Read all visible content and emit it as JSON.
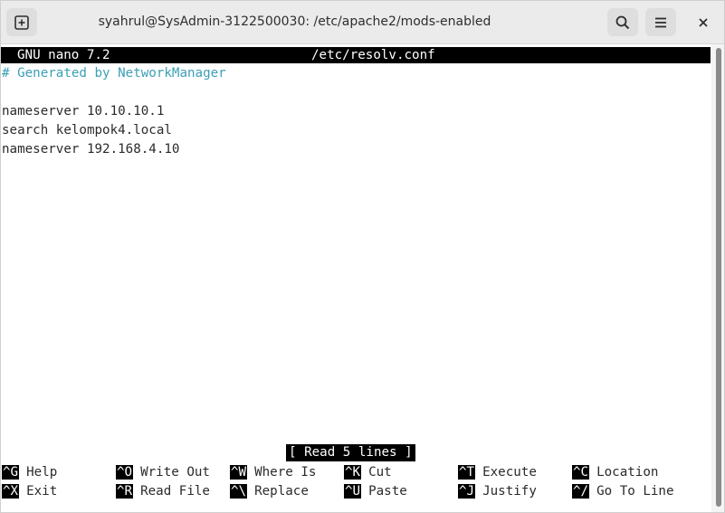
{
  "window": {
    "title": "syahrul@SysAdmin-3122500030: /etc/apache2/mods-enabled",
    "buttons": {
      "new_tab_icon": "new-tab-icon",
      "search_icon": "search-icon",
      "menu_icon": "hamburger-menu-icon",
      "close_icon": "close-icon"
    }
  },
  "nano": {
    "version_label": "GNU nano 7.2",
    "filename": "/etc/resolv.conf",
    "lines": [
      "# Generated by NetworkManager",
      "",
      "nameserver 10.10.10.1",
      "search kelompok4.local",
      "nameserver 192.168.4.10"
    ],
    "status_message": "[ Read 5 lines ]",
    "shortcuts_row1": [
      {
        "key": "^G",
        "label": "Help"
      },
      {
        "key": "^O",
        "label": "Write Out"
      },
      {
        "key": "^W",
        "label": "Where Is"
      },
      {
        "key": "^K",
        "label": "Cut"
      },
      {
        "key": "^T",
        "label": "Execute"
      },
      {
        "key": "^C",
        "label": "Location"
      }
    ],
    "shortcuts_row2": [
      {
        "key": "^X",
        "label": "Exit"
      },
      {
        "key": "^R",
        "label": "Read File"
      },
      {
        "key": "^\\",
        "label": "Replace"
      },
      {
        "key": "^U",
        "label": "Paste"
      },
      {
        "key": "^J",
        "label": "Justify"
      },
      {
        "key": "^/",
        "label": "Go To Line"
      }
    ]
  },
  "colors": {
    "comment": "#3a9fb6",
    "inverse_bg": "#000000",
    "inverse_fg": "#ffffff"
  }
}
